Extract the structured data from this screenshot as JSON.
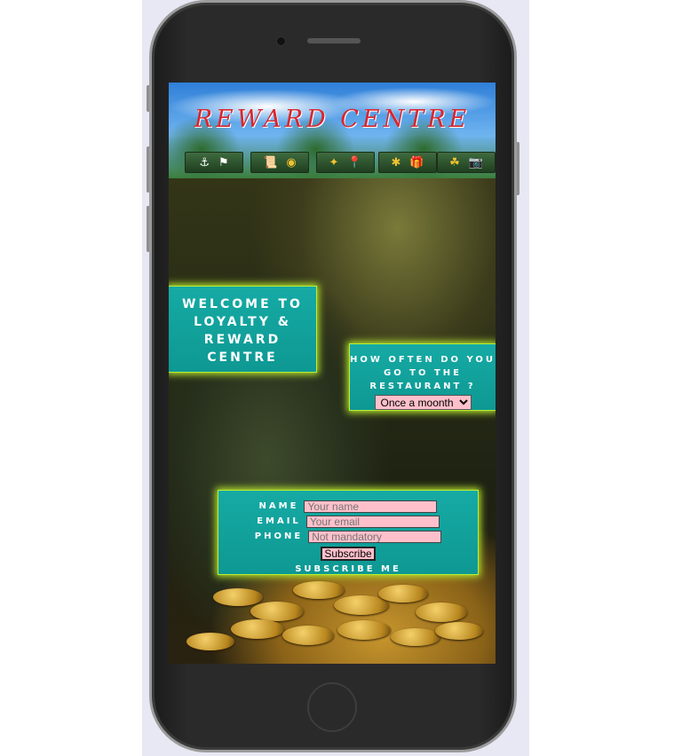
{
  "header": {
    "title": "REWARD CENTRE",
    "nav": [
      {
        "icons": [
          "anchor-icon",
          "flag-icon"
        ],
        "glyphs": [
          "⚓",
          "⚑"
        ]
      },
      {
        "icons": [
          "scroll-icon",
          "compass-icon"
        ],
        "glyphs": [
          "📜",
          "◉"
        ]
      },
      {
        "icons": [
          "parrot-icon",
          "pin-icon"
        ],
        "glyphs": [
          "✦",
          "📍"
        ]
      },
      {
        "icons": [
          "palm-icon",
          "gift-icon"
        ],
        "glyphs": [
          "✱",
          "🎁"
        ]
      },
      {
        "icons": [
          "island-icon",
          "camera-icon"
        ],
        "glyphs": [
          "☘",
          "📷"
        ]
      }
    ]
  },
  "welcome": {
    "text": "WELCOME TO LOYALTY & REWARD CENTRE"
  },
  "survey": {
    "question": "HOW OFTEN DO YOU GO TO THE RESTAURANT ?",
    "selected": "Once a moonth"
  },
  "subscribe": {
    "name_label": "NAME",
    "name_placeholder": "Your name",
    "email_label": "EMAIL",
    "email_placeholder": "Your email",
    "phone_label": "PHONE",
    "phone_placeholder": "Not mandatory",
    "button_label": "Subscribe",
    "caption": "SUBSCRIBE ME"
  },
  "colors": {
    "panel": "#16aaa4",
    "glow": "#b8e830",
    "title": "#d9262e",
    "input": "#ffc0cb"
  }
}
